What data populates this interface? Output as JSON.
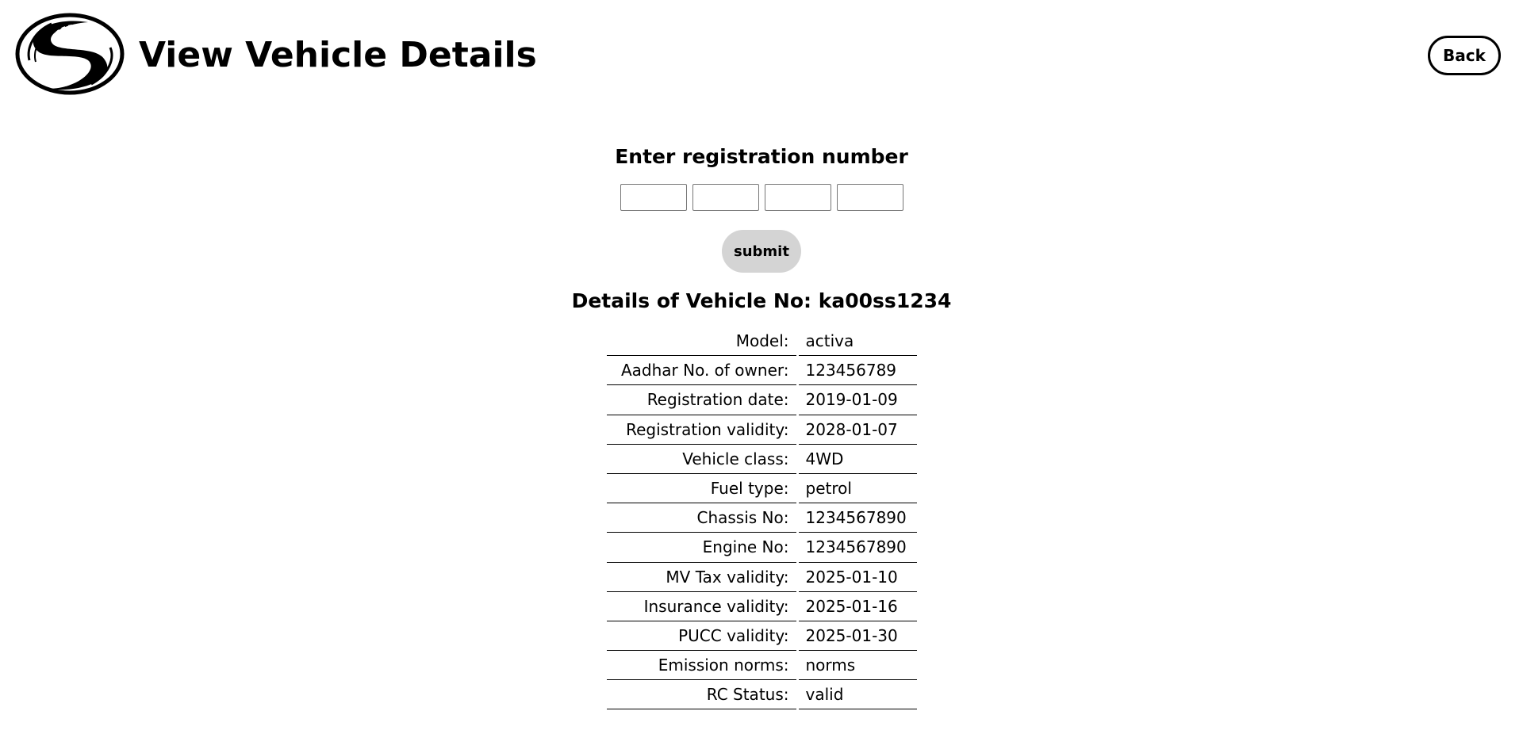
{
  "header": {
    "title": "View Vehicle Details",
    "back_label": "Back",
    "logo_icon": "road-logo-icon"
  },
  "form": {
    "prompt": "Enter registration number",
    "inputs": [
      {
        "value": "",
        "placeholder": ""
      },
      {
        "value": "",
        "placeholder": ""
      },
      {
        "value": "",
        "placeholder": ""
      },
      {
        "value": "",
        "placeholder": ""
      }
    ],
    "submit_label": "submit"
  },
  "details": {
    "heading_prefix": "Details of Vehicle No:",
    "vehicle_no": "ka00ss1234",
    "rows": [
      {
        "label": "Model:",
        "value": "activa"
      },
      {
        "label": "Aadhar No. of owner:",
        "value": "123456789"
      },
      {
        "label": "Registration date:",
        "value": "2019-01-09"
      },
      {
        "label": "Registration validity:",
        "value": "2028-01-07"
      },
      {
        "label": "Vehicle class:",
        "value": "4WD"
      },
      {
        "label": "Fuel type:",
        "value": "petrol"
      },
      {
        "label": "Chassis No:",
        "value": "1234567890"
      },
      {
        "label": "Engine No:",
        "value": "1234567890"
      },
      {
        "label": "MV Tax validity:",
        "value": "2025-01-10"
      },
      {
        "label": "Insurance validity:",
        "value": "2025-01-16"
      },
      {
        "label": "PUCC validity:",
        "value": "2025-01-30"
      },
      {
        "label": "Emission norms:",
        "value": "norms"
      },
      {
        "label": "RC Status:",
        "value": "valid"
      }
    ]
  }
}
